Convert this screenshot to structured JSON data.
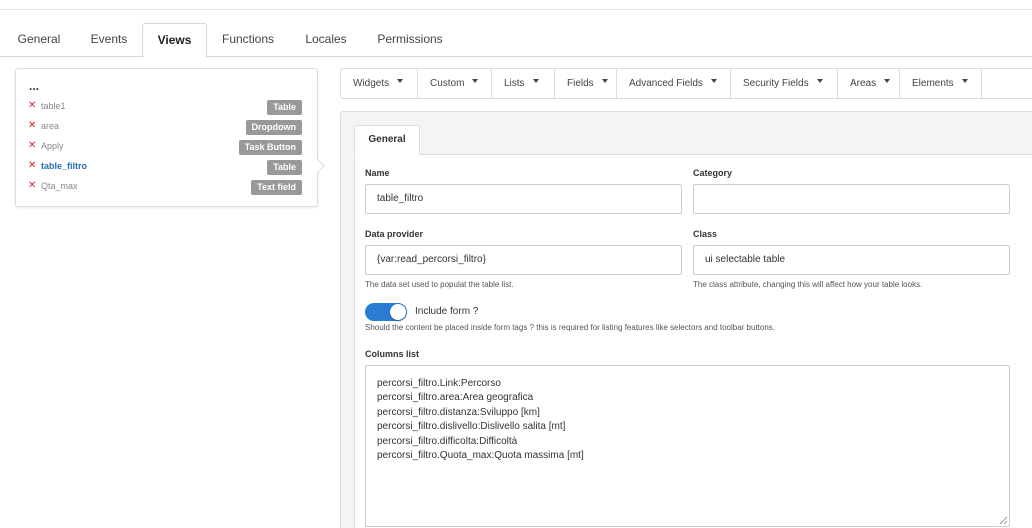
{
  "tabs": [
    "General",
    "Events",
    "Views",
    "Functions",
    "Locales",
    "Permissions"
  ],
  "active_tab": "Views",
  "tree": {
    "root": "...",
    "items": [
      {
        "label": "table1",
        "badge": "Table"
      },
      {
        "label": "area",
        "badge": "Dropdown"
      },
      {
        "label": "Apply",
        "badge": "Task Button"
      },
      {
        "label": "table_filtro",
        "badge": "Table",
        "selected": true
      },
      {
        "label": "Qta_max",
        "badge": "Text field"
      }
    ]
  },
  "toolbar": [
    "Widgets",
    "Custom",
    "Lists",
    "Fields",
    "Advanced Fields",
    "Security Fields",
    "Areas",
    "Elements"
  ],
  "inner_tab": "General",
  "form": {
    "name_label": "Name",
    "name_value": "table_filtro",
    "category_label": "Category",
    "category_value": "",
    "provider_label": "Data provider",
    "provider_value": "{var:read_percorsi_filtro}",
    "provider_help": "The data set used to populat the table list.",
    "class_label": "Class",
    "class_value": "ui selectable table",
    "class_help": "The class attribute, changing this will affect how your table looks.",
    "include_form_label": "Include form ?",
    "include_form_on": true,
    "include_form_help": "Should the content be placed inside form tags ? this is required for listing features like selectors and toolbar buttons.",
    "columns_label": "Columns list",
    "columns_value": "percorsi_filtro.Link:Percorso\npercorsi_filtro.area:Area geografica\npercorsi_filtro.distanza:Sviluppo [km]\npercorsi_filtro.dislivello:Dislivello salita [mt]\npercorsi_filtro.difficolta:Difficoltà\npercorsi_filtro.Quota_max:Quota massima [mt]"
  },
  "colors": {
    "accent": "#2b7bd3",
    "remove": "#d9251d",
    "badge": "#999999",
    "selected_link": "#2a6fb5"
  }
}
